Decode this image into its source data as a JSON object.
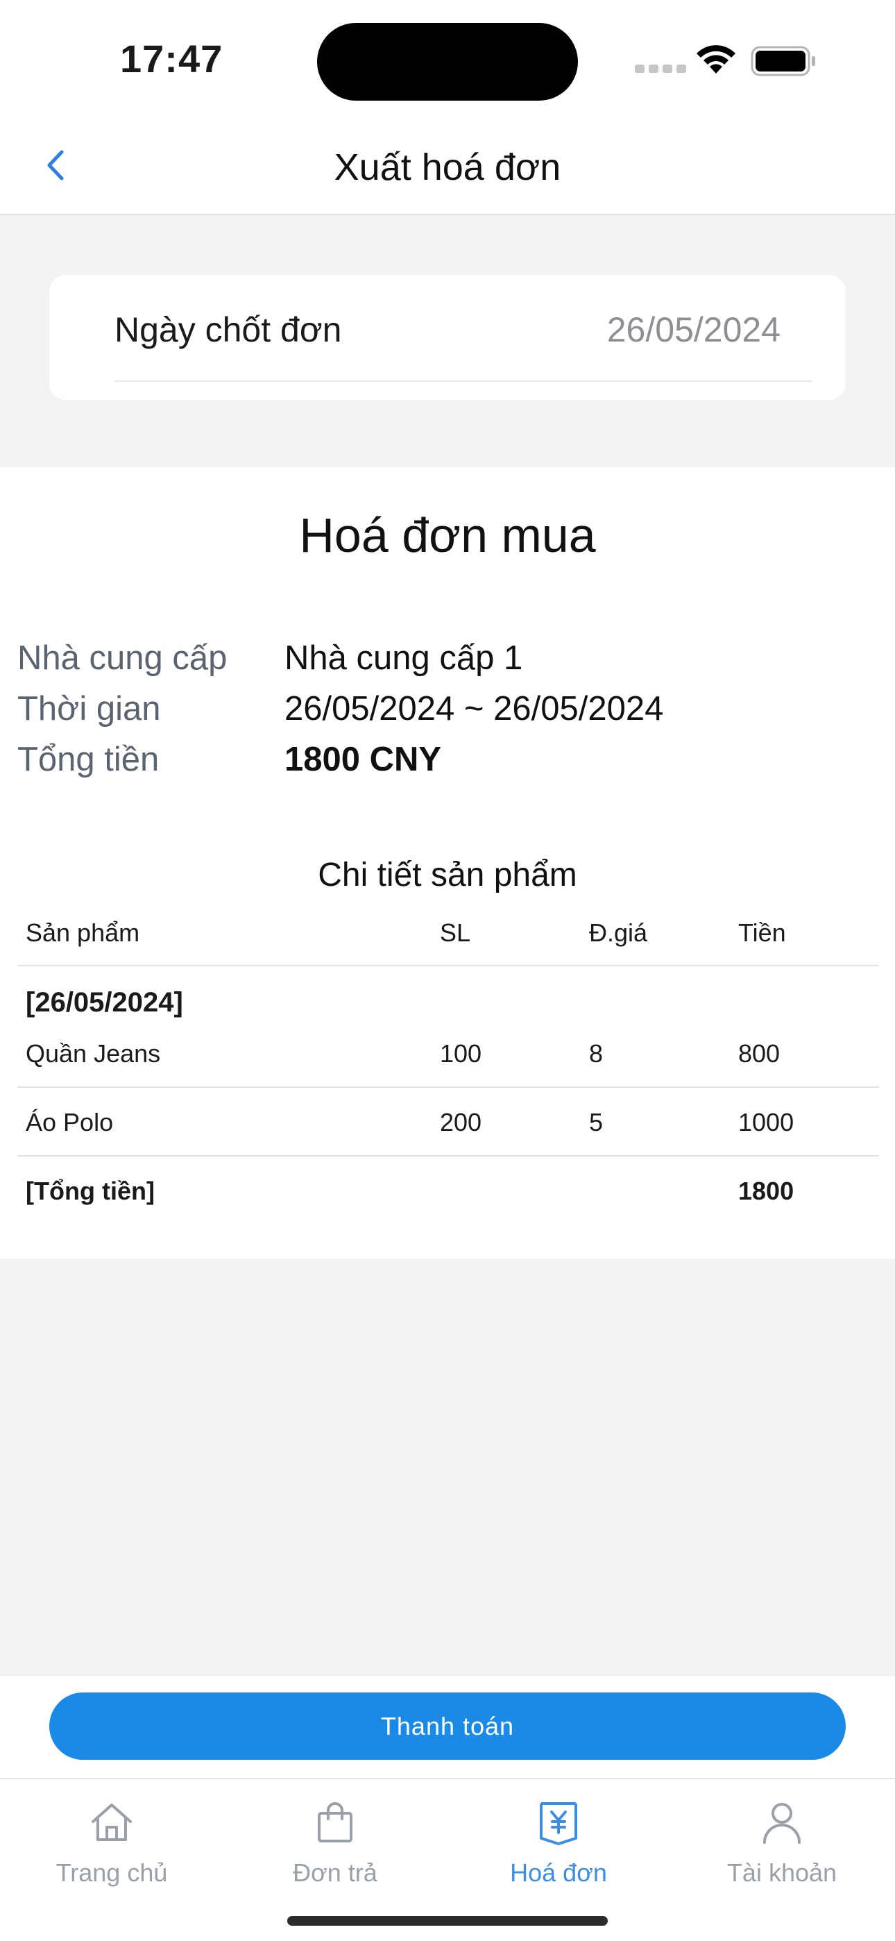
{
  "status_bar": {
    "time": "17:47"
  },
  "nav": {
    "title": "Xuất hoá đơn",
    "back_icon": "chevron-left-icon"
  },
  "date_card": {
    "label": "Ngày chốt đơn",
    "value": "26/05/2024"
  },
  "invoice": {
    "title": "Hoá đơn mua",
    "info": [
      {
        "label": "Nhà cung cấp",
        "value": "Nhà cung cấp 1"
      },
      {
        "label": "Thời gian",
        "value": "26/05/2024 ~ 26/05/2024"
      },
      {
        "label": "Tổng tiền",
        "value": "1800 CNY"
      }
    ],
    "section_title": "Chi tiết sản phẩm",
    "columns": [
      "Sản phẩm",
      "SL",
      "Đ.giá",
      "Tiền"
    ],
    "group_date": "[26/05/2024]",
    "rows": [
      {
        "product": "Quần Jeans",
        "qty": "100",
        "price": "8",
        "amount": "800"
      },
      {
        "product": "Áo Polo",
        "qty": "200",
        "price": "5",
        "amount": "1000"
      }
    ],
    "total_label": "[Tổng tiền]",
    "total_value": "1800"
  },
  "pay_button": {
    "label": "Thanh toán"
  },
  "tabs": [
    {
      "label": "Trang chủ",
      "icon": "home-icon",
      "active": false
    },
    {
      "label": "Đơn trả",
      "icon": "shopping-bag-icon",
      "active": false
    },
    {
      "label": "Hoá đơn",
      "icon": "yen-invoice-icon",
      "active": true
    },
    {
      "label": "Tài khoản",
      "icon": "user-icon",
      "active": false
    }
  ],
  "colors": {
    "accent": "#1a8ae6",
    "tab_active": "#3b8ee3",
    "tab_inactive": "#9aa0a8",
    "background": "#f2f3f5"
  }
}
